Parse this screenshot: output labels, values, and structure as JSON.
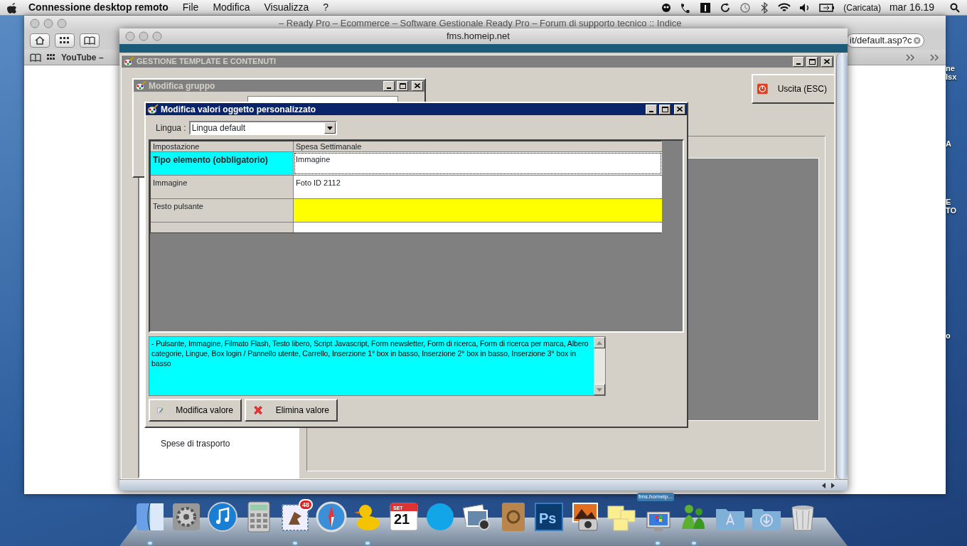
{
  "menu_bar": {
    "app_name": "Connessione desktop remoto",
    "menus": [
      "File",
      "Modifica",
      "Visualizza",
      "?"
    ],
    "battery_label": "(Caricata)",
    "clock": "mar 16.19"
  },
  "browser": {
    "title": "– Ready Pro – Ecommerce – Software Gestionale Ready Pro – Forum di supporto tecnico :: Indice",
    "address": "it/default.asp?c",
    "bookmarks": [
      "YouTube –"
    ]
  },
  "desktop_labels": [
    "ne",
    "lsx",
    "A",
    "E",
    "TO",
    "o"
  ],
  "remote_window": {
    "title": "fms.homeip.net"
  },
  "main_window": {
    "title": "GESTIONE TEMPLATE E CONTENUTI",
    "exit_button": "Uscita (ESC)",
    "tree_items": [
      "Spese di trasporto"
    ]
  },
  "group_window": {
    "title": "Modifica gruppo"
  },
  "dialog": {
    "title": "Modifica valori oggetto personalizzato",
    "language_label": "Lingua :",
    "language_value": "Lingua default",
    "table": {
      "columns": [
        "Impostazione",
        "Spesa Settimanale"
      ],
      "rows": [
        {
          "setting": "Tipo elemento (obbligatorio)",
          "value": "Immagine",
          "required": true,
          "selected": true,
          "color": "#ffffff"
        },
        {
          "setting": "Immagine",
          "value": "Foto ID 2112",
          "required": false,
          "selected": false,
          "color": "#ffffff"
        },
        {
          "setting": "Testo pulsante",
          "required": false,
          "selected": false,
          "color": "#ffff00"
        }
      ]
    },
    "description": "- Pulsante, Immagine, Filmato Flash, Testo libero, Script Javascript, Form newsletter, Form di ricerca, Form di ricerca per marca, Albero categorie, Lingue, Box login / Pannello utente, Carrello, Inserzione 1° box in basso, Inserzione 2° box in basso, Inserzione 3° box in basso",
    "buttons": [
      {
        "kind": "edit",
        "label": "Modifica valore"
      },
      {
        "kind": "delete",
        "label": "Elimina valore"
      }
    ]
  },
  "dock": [
    {
      "kind": "finder",
      "running": true
    },
    {
      "kind": "settings",
      "running": false
    },
    {
      "kind": "music",
      "running": false
    },
    {
      "kind": "calculator",
      "running": false
    },
    {
      "kind": "mail",
      "badge": "48",
      "running": true
    },
    {
      "kind": "compass",
      "running": false
    },
    {
      "kind": "duck",
      "running": true
    },
    {
      "kind": "calendar",
      "month": "SET",
      "day": "21",
      "running": false
    },
    {
      "kind": "chat",
      "running": false
    },
    {
      "kind": "photos",
      "running": false
    },
    {
      "kind": "contacts",
      "running": false
    },
    {
      "kind": "photoshop",
      "glyph": "Ps",
      "running": false
    },
    {
      "kind": "camera",
      "running": false
    },
    {
      "kind": "notes",
      "running": false
    },
    {
      "kind": "remote",
      "caption": "fms.homeip...",
      "running": true
    },
    {
      "kind": "messenger",
      "running": true
    },
    {
      "kind": "folder",
      "running": false
    },
    {
      "kind": "downloads",
      "running": false
    },
    {
      "kind": "trash",
      "running": false
    }
  ]
}
